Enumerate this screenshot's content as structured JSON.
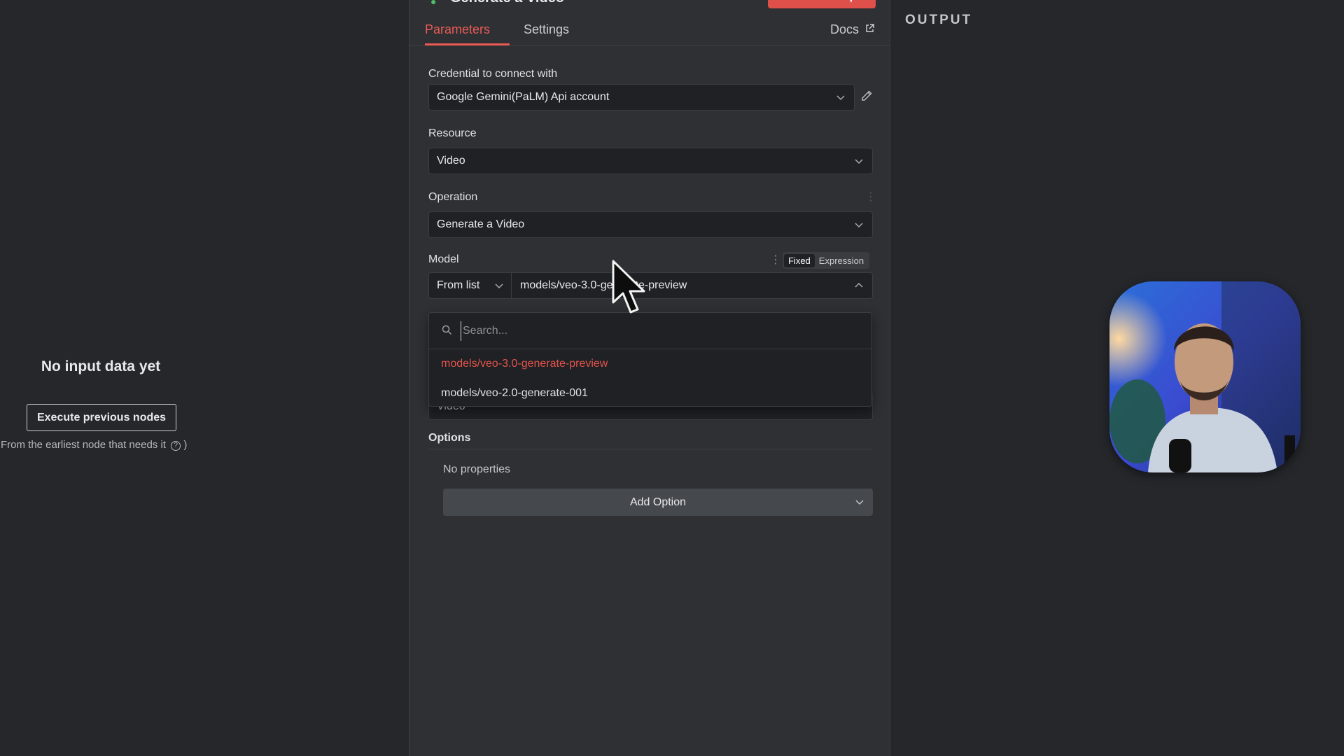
{
  "node": {
    "title": "Generate a Video",
    "execute_label": "Execute step"
  },
  "tabs": [
    {
      "label": "Parameters",
      "active": true
    },
    {
      "label": "Settings",
      "active": false
    }
  ],
  "docs_label": "Docs",
  "input_panel": {
    "empty_title": "No input data yet",
    "execute_previous_label": "Execute previous nodes",
    "hint": "From the earliest node that needs it",
    "hint_suffix": ")"
  },
  "credential": {
    "label": "Credential to connect with",
    "value": "Google Gemini(PaLM) Api account"
  },
  "resource": {
    "label": "Resource",
    "value": "Video"
  },
  "operation": {
    "label": "Operation",
    "value": "Generate a Video"
  },
  "model": {
    "label": "Model",
    "toggle": {
      "fixed": "Fixed",
      "expression": "Expression",
      "active": "Fixed"
    },
    "mode": "From list",
    "value": "models/veo-3.0-generate-preview",
    "dropdown": {
      "search_placeholder": "Search...",
      "items": [
        {
          "label": "models/veo-3.0-generate-preview",
          "selected": true
        },
        {
          "label": "models/veo-2.0-generate-001",
          "selected": false
        }
      ]
    }
  },
  "hidden_field": {
    "value": "Video"
  },
  "options": {
    "label": "Options",
    "empty_text": "No properties",
    "add_label": "Add Option"
  },
  "output_panel": {
    "title": "OUTPUT"
  },
  "colors": {
    "accent": "#ea5b56",
    "panel": "#2e3034",
    "background": "#25272b",
    "input_bg": "#1f2124"
  }
}
